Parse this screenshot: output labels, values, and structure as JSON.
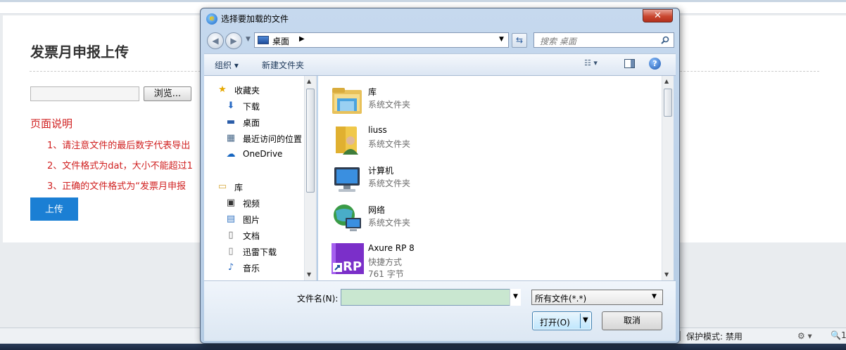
{
  "page": {
    "title": "发票月申报上传",
    "browse_label": "浏览...",
    "desc_title": "页面说明",
    "notes": [
      "1、请注意文件的最后数字代表导出",
      "2、文件格式为dat，大小不能超过1",
      "3、正确的文件格式为“发票月申报"
    ],
    "upload_label": "上传"
  },
  "statusbar": {
    "protected_mode": "保护模式: 禁用",
    "zoom": "1"
  },
  "dialog": {
    "title": "选择要加载的文件",
    "close_label": "✕",
    "address": {
      "location": "桌面"
    },
    "search": {
      "placeholder": "搜索 桌面"
    },
    "toolbar": {
      "organize": "组织 ▾",
      "new_folder": "新建文件夹"
    },
    "nav": {
      "favorites": "收藏夹",
      "downloads": "下载",
      "desktop": "桌面",
      "recent": "最近访问的位置",
      "onedrive": "OneDrive",
      "libraries": "库",
      "videos": "视频",
      "pictures": "图片",
      "documents": "文档",
      "thunder": "迅雷下载",
      "music": "音乐"
    },
    "files": [
      {
        "name": "库",
        "type": "系统文件夹",
        "size": "",
        "icon": "library-icon"
      },
      {
        "name": "liuss",
        "type": "系统文件夹",
        "size": "",
        "icon": "user-folder-icon"
      },
      {
        "name": "计算机",
        "type": "系统文件夹",
        "size": "",
        "icon": "computer-icon"
      },
      {
        "name": "网络",
        "type": "系统文件夹",
        "size": "",
        "icon": "network-icon"
      },
      {
        "name": "Axure RP 8",
        "type": "快捷方式",
        "size": "761 字节",
        "icon": "axure-shortcut-icon"
      }
    ],
    "bottom": {
      "filename_label": "文件名(N):",
      "filename_value": "",
      "filetype_value": "所有文件(*.*)",
      "open_label": "打开(O)",
      "cancel_label": "取消"
    }
  }
}
